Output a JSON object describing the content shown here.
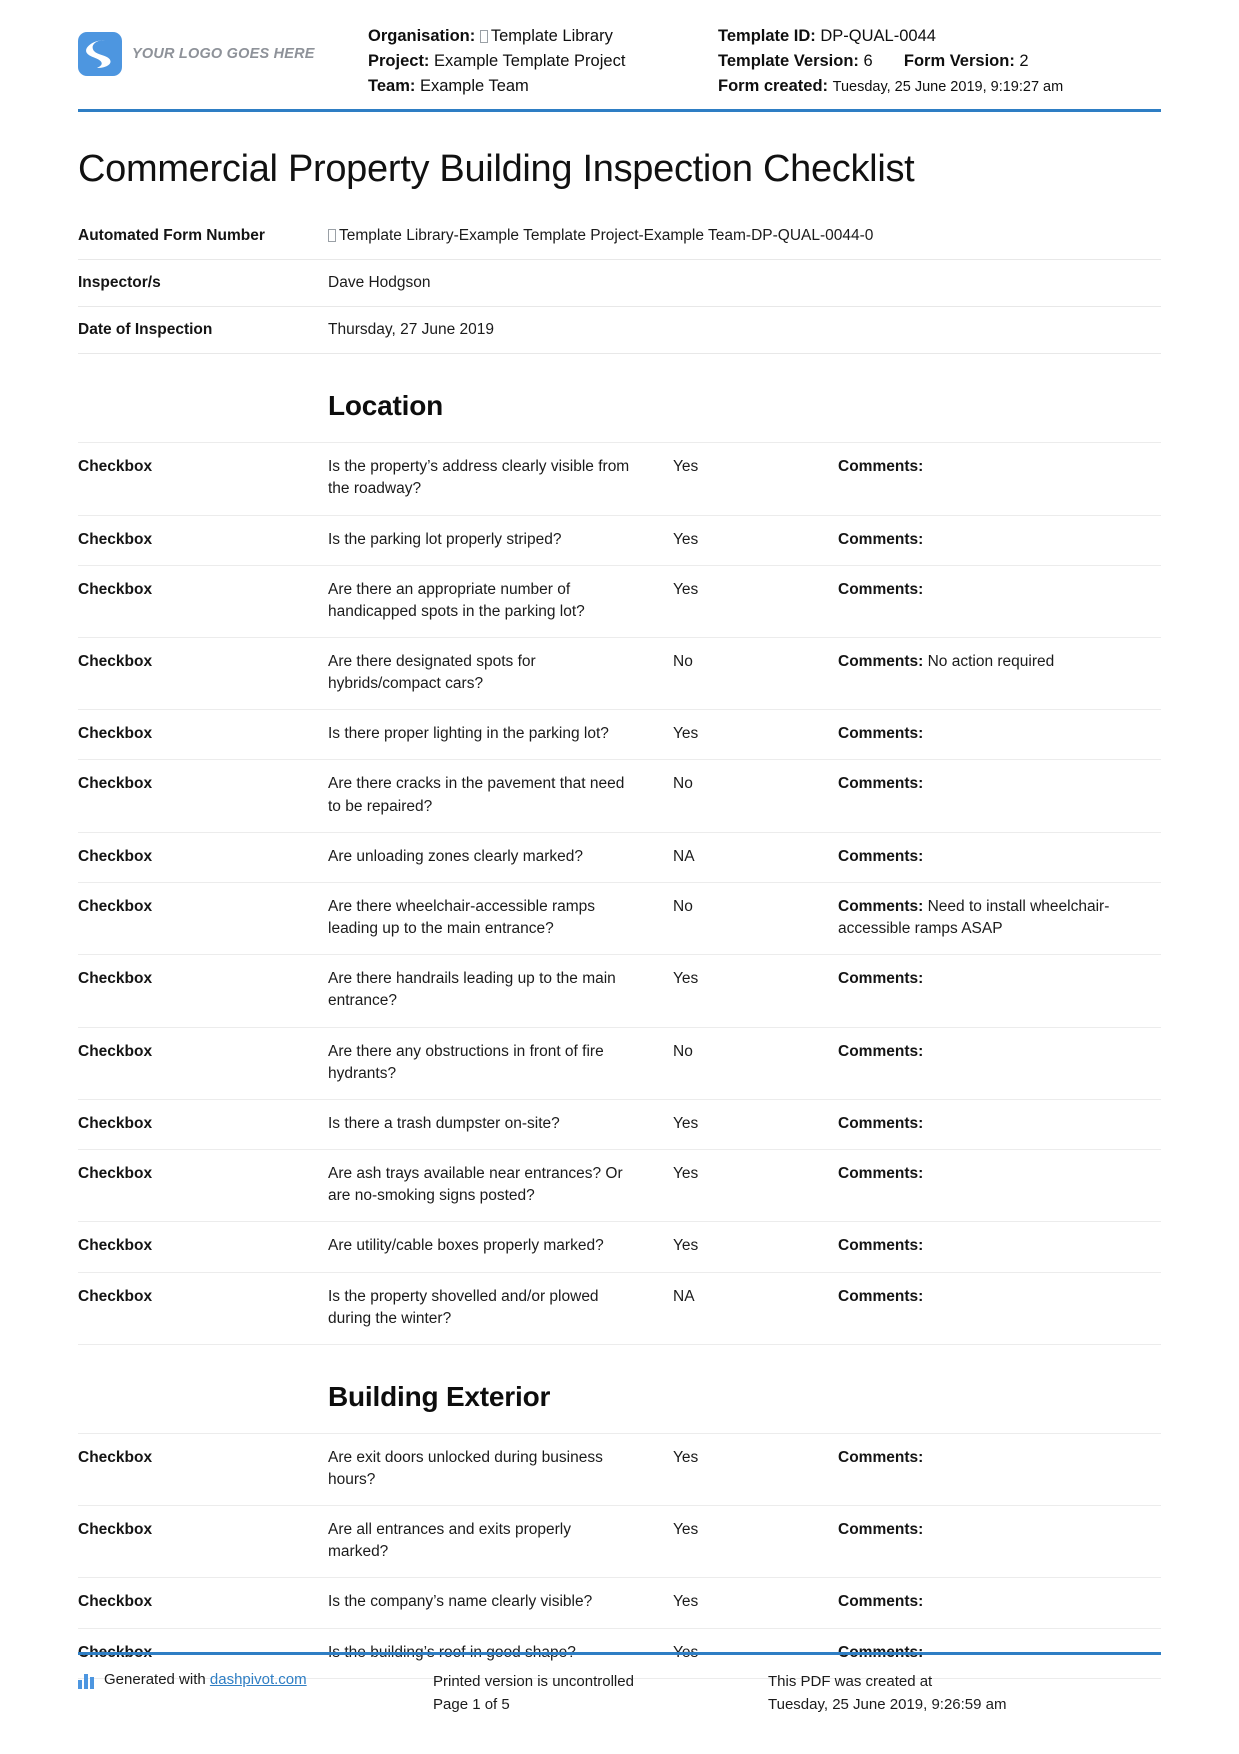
{
  "header": {
    "logo_text": "YOUR LOGO GOES HERE",
    "organisation_label": "Organisation:",
    "organisation_value": "Template Library",
    "project_label": "Project:",
    "project_value": "Example Template Project",
    "team_label": "Team:",
    "team_value": "Example Team",
    "template_id_label": "Template ID:",
    "template_id_value": "DP-QUAL-0044",
    "template_version_label": "Template Version:",
    "template_version_value": "6",
    "form_version_label": "Form Version:",
    "form_version_value": "2",
    "form_created_label": "Form created:",
    "form_created_value": "Tuesday, 25 June 2019, 9:19:27 am"
  },
  "title": "Commercial Property Building Inspection Checklist",
  "info_rows": [
    {
      "label": "Automated Form Number",
      "value": "Template Library-Example Template Project-Example Team-DP-QUAL-0044-0",
      "has_box_glyph": true
    },
    {
      "label": "Inspector/s",
      "value": "Dave Hodgson",
      "has_box_glyph": false
    },
    {
      "label": "Date of Inspection",
      "value": "Thursday, 27 June 2019",
      "has_box_glyph": false
    }
  ],
  "sections": [
    {
      "heading": "Location",
      "rows": [
        {
          "type": "Checkbox",
          "question": "Is the property’s address clearly visible from the roadway?",
          "answer": "Yes",
          "comments_label": "Comments:",
          "comments_value": ""
        },
        {
          "type": "Checkbox",
          "question": "Is the parking lot properly striped?",
          "answer": "Yes",
          "comments_label": "Comments:",
          "comments_value": ""
        },
        {
          "type": "Checkbox",
          "question": "Are there an appropriate number of handicapped spots in the parking lot?",
          "answer": "Yes",
          "comments_label": "Comments:",
          "comments_value": ""
        },
        {
          "type": "Checkbox",
          "question": "Are there designated spots for hybrids/compact cars?",
          "answer": "No",
          "comments_label": "Comments:",
          "comments_value": "No action required"
        },
        {
          "type": "Checkbox",
          "question": "Is there proper lighting in the parking lot?",
          "answer": "Yes",
          "comments_label": "Comments:",
          "comments_value": ""
        },
        {
          "type": "Checkbox",
          "question": "Are there cracks in the pavement that need to be repaired?",
          "answer": "No",
          "comments_label": "Comments:",
          "comments_value": ""
        },
        {
          "type": "Checkbox",
          "question": "Are unloading zones clearly marked?",
          "answer": "NA",
          "comments_label": "Comments:",
          "comments_value": ""
        },
        {
          "type": "Checkbox",
          "question": "Are there wheelchair-accessible ramps leading up to the main entrance?",
          "answer": "No",
          "comments_label": "Comments:",
          "comments_value": "Need to install wheelchair-accessible ramps ASAP"
        },
        {
          "type": "Checkbox",
          "question": "Are there handrails leading up to the main entrance?",
          "answer": "Yes",
          "comments_label": "Comments:",
          "comments_value": ""
        },
        {
          "type": "Checkbox",
          "question": "Are there any obstructions in front of fire hydrants?",
          "answer": "No",
          "comments_label": "Comments:",
          "comments_value": ""
        },
        {
          "type": "Checkbox",
          "question": "Is there a trash dumpster on-site?",
          "answer": "Yes",
          "comments_label": "Comments:",
          "comments_value": ""
        },
        {
          "type": "Checkbox",
          "question": "Are ash trays available near entrances? Or are no-smoking signs posted?",
          "answer": "Yes",
          "comments_label": "Comments:",
          "comments_value": ""
        },
        {
          "type": "Checkbox",
          "question": "Are utility/cable boxes properly marked?",
          "answer": "Yes",
          "comments_label": "Comments:",
          "comments_value": ""
        },
        {
          "type": "Checkbox",
          "question": "Is the property shovelled and/or plowed during the winter?",
          "answer": "NA",
          "comments_label": "Comments:",
          "comments_value": ""
        }
      ]
    },
    {
      "heading": "Building Exterior",
      "rows": [
        {
          "type": "Checkbox",
          "question": "Are exit doors unlocked during business hours?",
          "answer": "Yes",
          "comments_label": "Comments:",
          "comments_value": ""
        },
        {
          "type": "Checkbox",
          "question": "Are all entrances and exits properly marked?",
          "answer": "Yes",
          "comments_label": "Comments:",
          "comments_value": ""
        },
        {
          "type": "Checkbox",
          "question": "Is the company’s name clearly visible?",
          "answer": "Yes",
          "comments_label": "Comments:",
          "comments_value": ""
        },
        {
          "type": "Checkbox",
          "question": "Is the building’s roof in good shape?",
          "answer": "Yes",
          "comments_label": "Comments:",
          "comments_value": ""
        }
      ]
    }
  ],
  "footer": {
    "generated_prefix": "Generated with ",
    "generated_link": "dashpivot.com",
    "printed_line1": "Printed version is uncontrolled",
    "printed_line2": "Page 1 of 5",
    "created_line1": "This PDF was created at",
    "created_line2": "Tuesday, 25 June 2019, 9:26:59 am"
  },
  "colors": {
    "accent": "#2e7ec4",
    "logo": "#4d96e0",
    "rule": "#ececec"
  }
}
